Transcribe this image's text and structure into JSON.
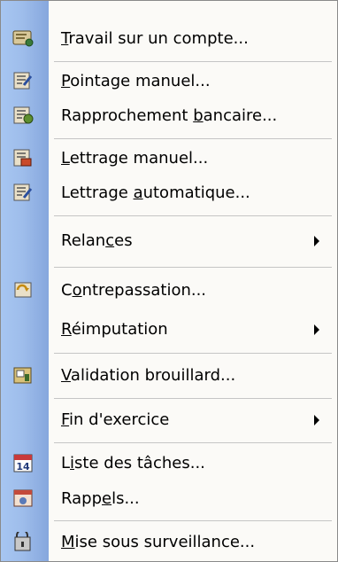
{
  "menu": {
    "items": [
      {
        "before": "",
        "hot": "T",
        "after": "ravail sur un compte...",
        "icon": "account-book-icon",
        "submenu": false
      },
      {
        "before": "",
        "hot": "P",
        "after": "ointage manuel...",
        "icon": "manual-check-icon",
        "submenu": false
      },
      {
        "before": "Rapprochement ",
        "hot": "b",
        "after": "ancaire...",
        "icon": "bank-reconcile-icon",
        "submenu": false
      },
      {
        "before": "",
        "hot": "L",
        "after": "ettrage manuel...",
        "icon": "manual-lettering-icon",
        "submenu": false
      },
      {
        "before": "Lettrage ",
        "hot": "a",
        "after": "utomatique...",
        "icon": "auto-lettering-icon",
        "submenu": false
      },
      {
        "before": "Relan",
        "hot": "c",
        "after": "es",
        "icon": "",
        "submenu": true
      },
      {
        "before": "C",
        "hot": "o",
        "after": "ntrepassation...",
        "icon": "reverse-entry-icon",
        "submenu": false
      },
      {
        "before": "",
        "hot": "R",
        "after": "éimputation",
        "icon": "",
        "submenu": true
      },
      {
        "before": "",
        "hot": "V",
        "after": "alidation brouillard...",
        "icon": "validation-icon",
        "submenu": false
      },
      {
        "before": "",
        "hot": "F",
        "after": "in d'exercice",
        "icon": "",
        "submenu": true
      },
      {
        "before": "L",
        "hot": "i",
        "after": "ste des tâches...",
        "icon": "calendar-icon",
        "submenu": false
      },
      {
        "before": "Rapp",
        "hot": "e",
        "after": "ls...",
        "icon": "reminder-icon",
        "submenu": false
      },
      {
        "before": "",
        "hot": "M",
        "after": "ise sous surveillance...",
        "icon": "surveillance-icon",
        "submenu": false
      }
    ],
    "calendar_day": "14"
  }
}
